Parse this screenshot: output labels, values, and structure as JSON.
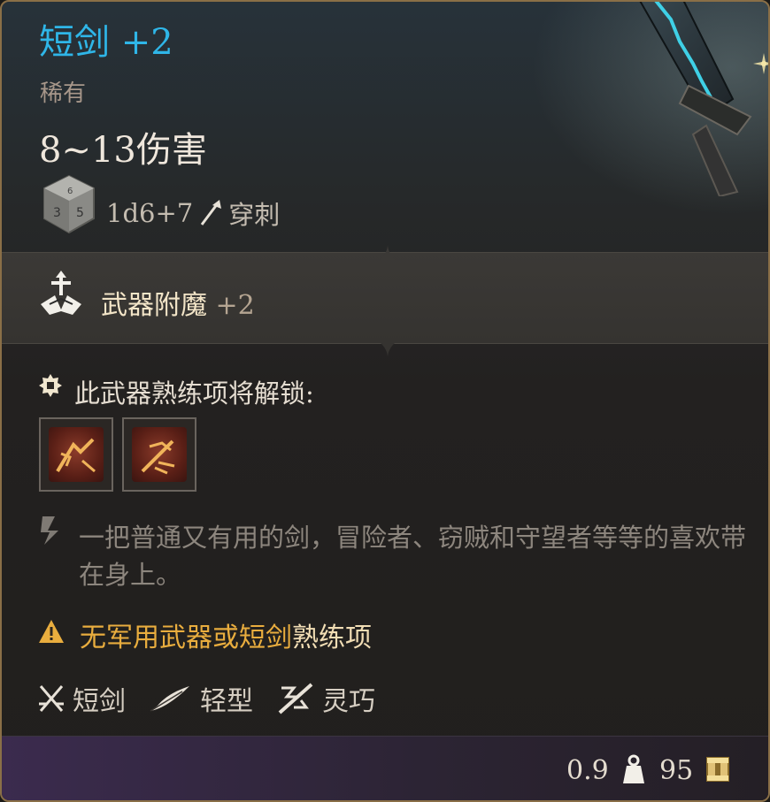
{
  "item": {
    "title": "短剑 +2",
    "rarity": "稀有",
    "damage": "8~13伤害",
    "damage_dice": "1d6+7",
    "damage_type": "穿刺",
    "icons": {
      "dice": "d6-dice-icon",
      "damage_type": "piercing-arrow-icon"
    }
  },
  "enchantment": {
    "name": "武器附魔",
    "value": "+2",
    "icon": "weapon-enchantment-icon"
  },
  "proficiency": {
    "header": "此武器熟练项将解锁:",
    "actions": [
      {
        "icon": "weapon-action-slot-1-icon"
      },
      {
        "icon": "weapon-action-slot-2-icon"
      }
    ]
  },
  "flavor_text": "一把普通又有用的剑，冒险者、窃贼和守望者等等的喜欢带在身上。",
  "warning": {
    "main": "无军用武器或短剑",
    "tail": "熟练项",
    "icon": "warning-triangle-icon"
  },
  "properties": [
    {
      "label": "短剑",
      "icon": "crossed-swords-icon"
    },
    {
      "label": "轻型",
      "icon": "feather-icon"
    },
    {
      "label": "灵巧",
      "icon": "finesse-icon"
    }
  ],
  "footer": {
    "weight": "0.9",
    "price": "95",
    "weight_icon": "weight-icon",
    "price_icon": "gold-coin-icon"
  },
  "colors": {
    "title": "#2fb6e8",
    "warning": "#e9ad3e",
    "border": "#8a6f47"
  }
}
